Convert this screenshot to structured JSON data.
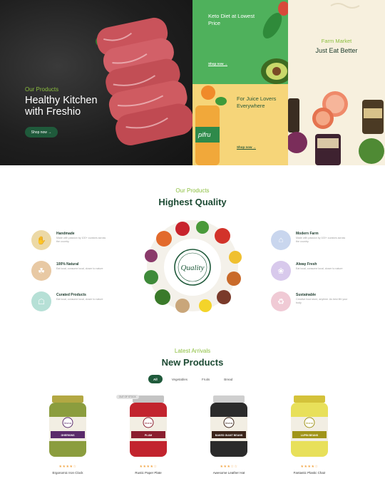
{
  "hero": {
    "main": {
      "eyebrow": "Our Products",
      "title": "Healthy Kitchen with Freshio",
      "button": "Shop now →"
    },
    "diet": {
      "title": "Keto Diet at Lowest Price",
      "link": "Shop now →"
    },
    "juice": {
      "title": "For Juice Lovers Everywhere",
      "link": "Shop now →"
    },
    "farm": {
      "eyebrow": "Farm Market",
      "title": "Just Eat Better"
    }
  },
  "quality": {
    "eyebrow": "Our Products",
    "title": "Highest Quality",
    "seal_text": "Quality",
    "left_features": [
      {
        "title": "Handmade",
        "desc": "Made with passion by 100+ curators across the country",
        "icon": "hand-icon",
        "color": "#ecd9a6"
      },
      {
        "title": "100% Natural",
        "desc": "Eat local, consume local, closer to nature",
        "icon": "leaf-icon",
        "color": "#e8c9a4"
      },
      {
        "title": "Curated Products",
        "desc": "Eat local, consume local, closer to nature",
        "icon": "basket-icon",
        "color": "#b6e0d6"
      }
    ],
    "right_features": [
      {
        "title": "Modern Farm",
        "desc": "Made with passion by 100+ curators across the country",
        "icon": "farm-icon",
        "color": "#c9d6ee"
      },
      {
        "title": "Alway Fresh",
        "desc": "Eat local, consume local, closer to nature",
        "icon": "fruit-icon",
        "color": "#d8c9ec"
      },
      {
        "title": "Sustainable",
        "desc": "Creative food store, anytime. As best life your body",
        "icon": "sustain-icon",
        "color": "#f0cad5"
      }
    ]
  },
  "products": {
    "eyebrow": "Latest Arrivals",
    "title": "New Products",
    "tabs": [
      "All",
      "Vegetables",
      "Fruits",
      "Bread"
    ],
    "badge": "OUT OF STOCK",
    "items": [
      {
        "name": "Ergonomic Iron Clock",
        "rating": 4,
        "jar_lid": "#b3a843",
        "jar_body": "#8b9d3e",
        "label_color": "#5a2a6a",
        "label_text": "GHERKINS"
      },
      {
        "name": "Rustic Paper Plate",
        "rating": 4,
        "jar_lid": "#c4c4c4",
        "jar_body": "#c2242e",
        "label_color": "#8a1e2e",
        "label_text": "PLUM"
      },
      {
        "name": "Awesome Leather Hat",
        "rating": 3,
        "jar_lid": "#cfcfcf",
        "jar_body": "#2b2b2b",
        "label_color": "#3b2418",
        "label_text": "BAKED GIANT BEANS"
      },
      {
        "name": "Fantastic Plastic Chair",
        "rating": 4,
        "jar_lid": "#d4c23a",
        "jar_body": "#e8e05a",
        "label_color": "#a09418",
        "label_text": "LUPIN BEANS"
      }
    ]
  }
}
